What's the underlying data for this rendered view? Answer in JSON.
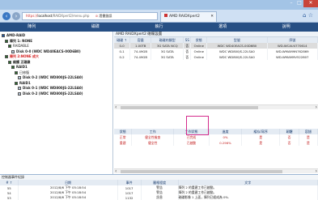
{
  "browser": {
    "url_scheme": "https://",
    "url_host": "localhost",
    "url_path": "/RAIDXpert2/menu.php",
    "cert_error": "證書錯誤",
    "tab_title": "AMD RAIDXpert2"
  },
  "menu": [
    "陣列",
    "磁碟",
    "執行",
    "選項",
    "說明"
  ],
  "tree": [
    {
      "label": "AMD-RAID",
      "cls": "bold",
      "icon": "ctl"
    },
    {
      "label": "陣列 1: NONE",
      "cls": "bold",
      "icon": "raid"
    },
    {
      "label": "RAIDABLE",
      "cls": "",
      "icon": "raid"
    },
    {
      "label": "Disk 0-0 (WDC WD40EACS-00D6B0)",
      "cls": "bold",
      "icon": "disk"
    },
    {
      "label": "陣列 2:NONE 成大",
      "cls": "red bold",
      "icon": "raid"
    },
    {
      "label": "維護 正磁碟",
      "cls": "bold",
      "icon": "raid"
    },
    {
      "label": "RAID1",
      "cls": "bold",
      "icon": "raid"
    },
    {
      "label": "已修復",
      "cls": "",
      "icon": "raid"
    },
    {
      "label": "Disk 0-2 (WDC WD800JS-22LSA0)",
      "cls": "bold",
      "icon": "disk"
    },
    {
      "label": "RAID1",
      "cls": "bold",
      "icon": "raid"
    },
    {
      "label": "Disk 0-1 (WDC WD800JS-22LSA0)",
      "cls": "bold",
      "icon": "disk"
    },
    {
      "label": "Disk 0-2 (WDC WD800JS-22LSA0)",
      "cls": "bold",
      "icon": "disk"
    }
  ],
  "main_title": "AMD RAIDXpert2 磁碟設置",
  "disk_cols": [
    "磁碟 ↑",
    "容量",
    "磁碟的類型",
    "SS",
    "狀態",
    "型號",
    "序號"
  ],
  "disks": [
    [
      "0-0",
      "1.00TB",
      "3G SATA NCQ",
      "否",
      "Online",
      "WDC WD40EACS-00D6B0",
      "WD-WCAU4770614"
    ],
    [
      "0-1",
      "74.49GB",
      "3G SATA",
      "否",
      "Online",
      "WDC WD800JS-22LSA0",
      "WD-WMAM9N762869"
    ],
    [
      "0-2",
      "74.49GB",
      "3G SATA",
      "否",
      "Online",
      "WDC WD800JS-22LSA0",
      "WD-WMAM9V522807"
    ]
  ],
  "status_cols": [
    "狀態",
    "工作",
    "工作狀態",
    "進度",
    "緩存/寫序",
    "韌體",
    "容錯"
  ],
  "status_rows": [
    [
      "正常",
      "健全性檢查",
      "已完成",
      "0%",
      "是",
      "否",
      "是"
    ],
    [
      "重建",
      "健全性",
      "已啟動",
      "0.296%",
      "是",
      "否",
      "是"
    ]
  ],
  "events_title": "控制器事件紀錄",
  "event_cols": [
    "# ↑",
    "日期",
    "事件",
    "嚴格程度",
    "文字"
  ],
  "events": [
    [
      "55",
      "2012/8/6 下午 05:18:54",
      "1017",
      "警告",
      "陣列 2 的重建工作已啟動。"
    ],
    [
      "54",
      "2012/8/6 下午 05:18:54",
      "1017",
      "警告",
      "陣列 2 的重建工作已啟動。"
    ],
    [
      "53",
      "2012/8/6 下午 05:18:54",
      "1132",
      "訊息",
      "磁碟影像 1 上面，陣列已經成為 0%."
    ]
  ]
}
